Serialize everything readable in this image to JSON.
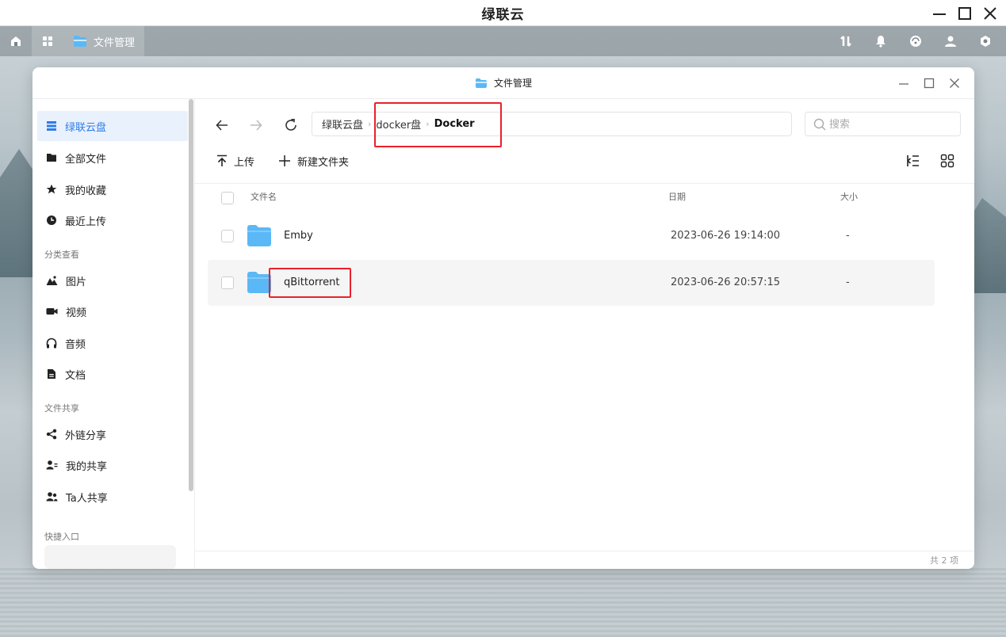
{
  "os": {
    "title": "绿联云"
  },
  "taskbar": {
    "app_label": "文件管理"
  },
  "window": {
    "title": "文件管理"
  },
  "sidebar": {
    "items": [
      {
        "label": "绿联云盘",
        "icon": "storage-icon",
        "active": true
      },
      {
        "label": "全部文件",
        "icon": "file-icon"
      },
      {
        "label": "我的收藏",
        "icon": "star-icon"
      },
      {
        "label": "最近上传",
        "icon": "clock-icon"
      }
    ],
    "section_category": "分类查看",
    "category_items": [
      {
        "label": "图片",
        "icon": "image-icon"
      },
      {
        "label": "视频",
        "icon": "video-icon"
      },
      {
        "label": "音频",
        "icon": "headphones-icon"
      },
      {
        "label": "文档",
        "icon": "document-icon"
      }
    ],
    "section_share": "文件共享",
    "share_items": [
      {
        "label": "外链分享",
        "icon": "share-icon"
      },
      {
        "label": "我的共享",
        "icon": "user-share-icon"
      },
      {
        "label": "Ta人共享",
        "icon": "users-icon"
      }
    ],
    "section_quick": "快捷入口"
  },
  "breadcrumb": {
    "items": [
      "绿联云盘",
      "docker盘",
      "Docker"
    ]
  },
  "search": {
    "placeholder": "搜索"
  },
  "toolbar": {
    "upload_label": "上传",
    "new_folder_label": "新建文件夹"
  },
  "list": {
    "columns": {
      "name": "文件名",
      "date": "日期",
      "size": "大小"
    },
    "rows": [
      {
        "name": "Emby",
        "date": "2023-06-26 19:14:00",
        "size": "-"
      },
      {
        "name": "qBittorrent",
        "date": "2023-06-26 20:57:15",
        "size": "-"
      }
    ],
    "footer": "共 2 项"
  },
  "colors": {
    "accent": "#2e7ce9",
    "folder": "#5bb8f6",
    "highlight": "#e8222b"
  }
}
